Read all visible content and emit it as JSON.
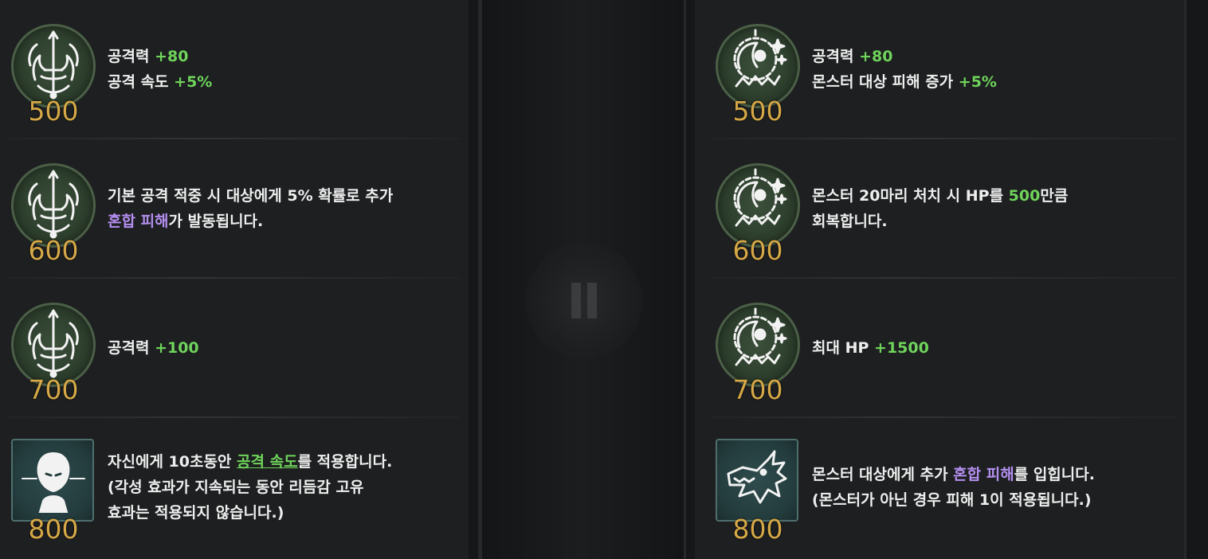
{
  "left_panel": {
    "items": [
      {
        "cost": "500",
        "icon": "sword-emblem-icon",
        "lines": [
          [
            {
              "t": "공격력 ",
              "c": ""
            },
            {
              "t": "+80",
              "c": "g"
            }
          ],
          [
            {
              "t": "공격 속도 ",
              "c": ""
            },
            {
              "t": "+5%",
              "c": "g"
            }
          ]
        ]
      },
      {
        "cost": "600",
        "icon": "sword-emblem-icon",
        "lines": [
          [
            {
              "t": "기본 공격 적중 시 대상에게 5% 확률로 추가",
              "c": ""
            }
          ],
          [
            {
              "t": "혼합 피해",
              "c": "p"
            },
            {
              "t": "가 발동됩니다.",
              "c": ""
            }
          ]
        ]
      },
      {
        "cost": "700",
        "icon": "sword-emblem-icon",
        "lines": [
          [
            {
              "t": "공격력 ",
              "c": ""
            },
            {
              "t": "+100",
              "c": "g"
            }
          ]
        ]
      },
      {
        "cost": "800",
        "icon": "awakened-face-icon",
        "lines": [
          [
            {
              "t": "자신에게 10초동안 ",
              "c": ""
            },
            {
              "t": "공격 속도",
              "c": "u"
            },
            {
              "t": "를 적용합니다.",
              "c": ""
            }
          ],
          [
            {
              "t": "(각성 효과가 지속되는 동안 리듬감 고유",
              "c": ""
            }
          ],
          [
            {
              "t": "효과는 적용되지 않습니다.)",
              "c": ""
            }
          ]
        ]
      }
    ]
  },
  "right_panel": {
    "items": [
      {
        "cost": "500",
        "icon": "monster-crest-icon",
        "lines": [
          [
            {
              "t": "공격력 ",
              "c": ""
            },
            {
              "t": "+80",
              "c": "g"
            }
          ],
          [
            {
              "t": "몬스터 대상 피해 증가 ",
              "c": ""
            },
            {
              "t": "+5%",
              "c": "g"
            }
          ]
        ]
      },
      {
        "cost": "600",
        "icon": "monster-crest-icon",
        "lines": [
          [
            {
              "t": "몬스터 20마리 처치 시 HP를 ",
              "c": ""
            },
            {
              "t": "500",
              "c": "g"
            },
            {
              "t": "만큼",
              "c": ""
            }
          ],
          [
            {
              "t": "회복합니다.",
              "c": ""
            }
          ]
        ]
      },
      {
        "cost": "700",
        "icon": "monster-crest-icon",
        "lines": [
          [
            {
              "t": "최대 HP ",
              "c": ""
            },
            {
              "t": "+1500",
              "c": "g"
            }
          ]
        ]
      },
      {
        "cost": "800",
        "icon": "dragon-head-icon",
        "lines": [
          [
            {
              "t": "몬스터 대상에게 추가 ",
              "c": ""
            },
            {
              "t": "혼합 피해",
              "c": "p"
            },
            {
              "t": "를 입힙니다.",
              "c": ""
            }
          ],
          [
            {
              "t": "(몬스터가 아닌 경우 피해 1이 적용됩니다.)",
              "c": ""
            }
          ]
        ]
      }
    ]
  },
  "overlay": {
    "icon": "pause-icon"
  },
  "colors": {
    "green": "#6fd35b",
    "purple": "#b48ff0",
    "gold": "#d6a847"
  }
}
